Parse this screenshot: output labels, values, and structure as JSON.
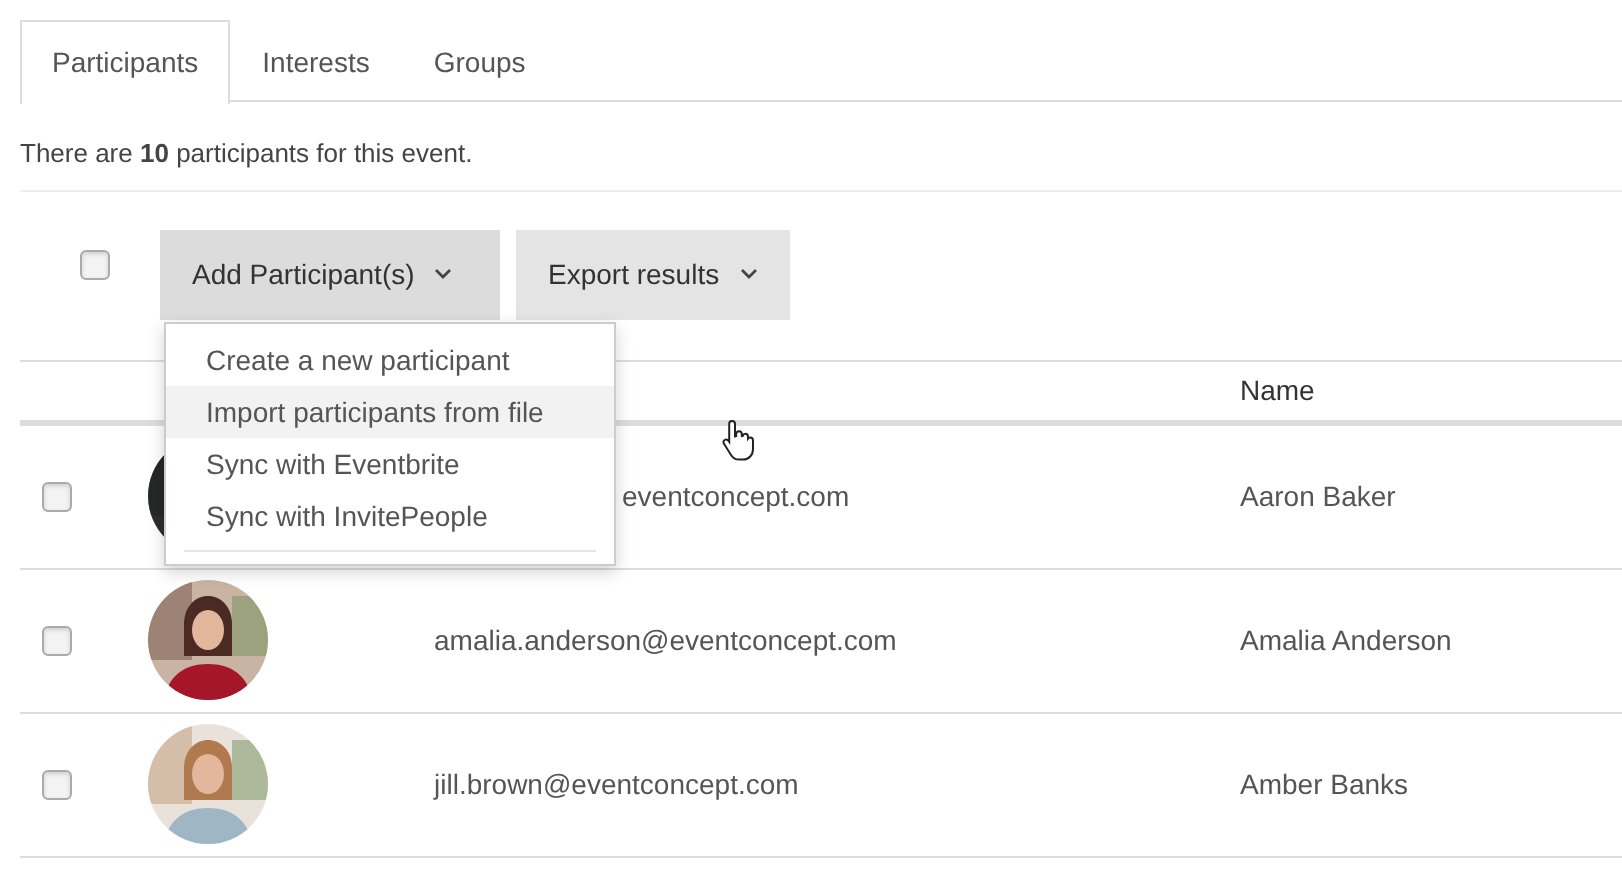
{
  "tabs": [
    {
      "label": "Participants",
      "selected": true
    },
    {
      "label": "Interests",
      "selected": false
    },
    {
      "label": "Groups",
      "selected": false
    }
  ],
  "summary": "There are **10** participants for this event.",
  "toolbar": {
    "select_all_checked": false,
    "buttons": [
      {
        "label": "Add Participant(s)",
        "expanded": true
      },
      {
        "label": "Export results",
        "expanded": false
      }
    ]
  },
  "menu": {
    "items": [
      {
        "label": "Create a new participant",
        "hovered": false
      },
      {
        "label": "Import participants from file",
        "hovered": true
      },
      {
        "label": "Sync with Eventbrite",
        "hovered": false
      },
      {
        "label": "Sync with InvitePeople",
        "hovered": false
      }
    ]
  },
  "table": {
    "name_header": "Name",
    "rows": [
      {
        "checked": false,
        "email": "eventconcept.com",
        "name": "Aaron Baker"
      },
      {
        "checked": false,
        "email": "amalia.anderson@eventconcept.com",
        "name": "Amalia Anderson"
      },
      {
        "checked": false,
        "email": "jill.brown@eventconcept.com",
        "name": "Amber Banks"
      }
    ]
  }
}
